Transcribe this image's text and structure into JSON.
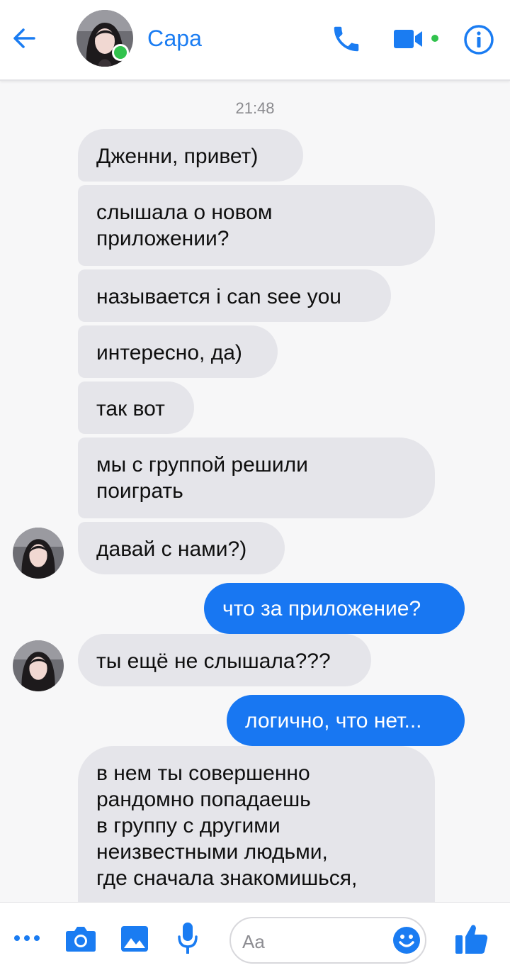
{
  "header": {
    "contact_name": "Сара",
    "online": true,
    "icons": [
      "back-arrow-icon",
      "phone-icon",
      "video-camera-icon",
      "info-icon"
    ]
  },
  "chat": {
    "timestamp": "21:48",
    "messages": [
      {
        "from": "Сара",
        "direction": "in",
        "text": "Дженни, привет)"
      },
      {
        "from": "Сара",
        "direction": "in",
        "text": "слышала о новом\nприложении?"
      },
      {
        "from": "Сара",
        "direction": "in",
        "text": "называется i can see you"
      },
      {
        "from": "Сара",
        "direction": "in",
        "text": "интересно, да)"
      },
      {
        "from": "Сара",
        "direction": "in",
        "text": "так вот"
      },
      {
        "from": "Сара",
        "direction": "in",
        "text": "мы с группой решили\nпоиграть"
      },
      {
        "from": "Сара",
        "direction": "in",
        "text": "давай с нами?)"
      },
      {
        "from": "me",
        "direction": "out",
        "text": "что за приложение?"
      },
      {
        "from": "Сара",
        "direction": "in",
        "text": "ты ещё не слышала???"
      },
      {
        "from": "me",
        "direction": "out",
        "text": "логично, что нет..."
      },
      {
        "from": "Сара",
        "direction": "in",
        "text": "в нем ты совершенно\nрандомно попадаешь\nв группу с другими\nнеизвестными людьми,\nгде сначала знакомишься,"
      }
    ]
  },
  "composer": {
    "placeholder": "Aa",
    "icons": [
      "more-icon",
      "camera-icon",
      "image-icon",
      "microphone-icon",
      "emoji-icon",
      "thumbs-up-icon"
    ]
  },
  "colors": {
    "accent": "#1877f2",
    "online": "#31c24d",
    "incoming_bubble": "#e5e5ea",
    "background": "#f7f7f8"
  }
}
